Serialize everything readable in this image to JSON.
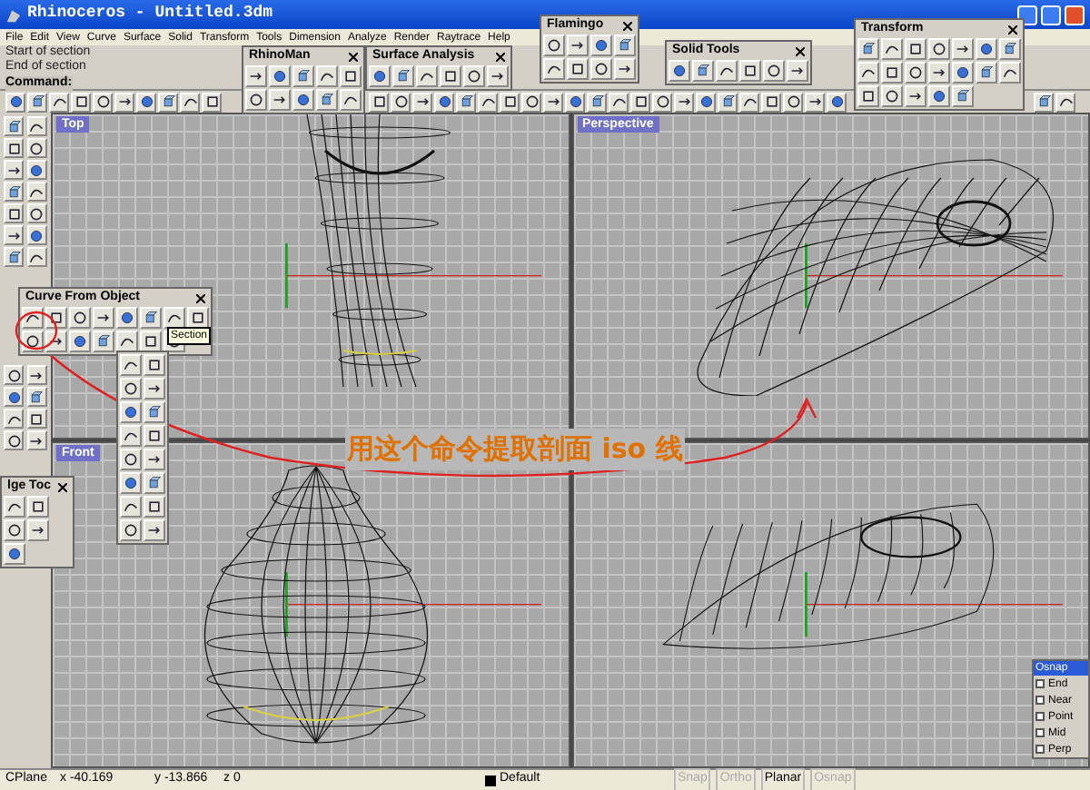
{
  "window": {
    "title": "Rhinoceros - Untitled.3dm"
  },
  "menu": [
    "File",
    "Edit",
    "View",
    "Curve",
    "Surface",
    "Solid",
    "Transform",
    "Tools",
    "Dimension",
    "Analyze",
    "Render",
    "Raytrace",
    "Help"
  ],
  "command_history": [
    "Start of section",
    "End of section"
  ],
  "command_prompt": "Command:",
  "viewports": [
    {
      "label": "Top",
      "kind": "vase"
    },
    {
      "label": "Perspective",
      "kind": "perspective"
    },
    {
      "label": "Front",
      "kind": "bulb"
    },
    {
      "kind": "side"
    }
  ],
  "annotation": "用这个命令提取剖面 iso 线",
  "floating_toolbars": [
    {
      "title": "RhinoMan",
      "kind": "rhinoman"
    },
    {
      "title": "Surface Analysis",
      "kind": "surface"
    },
    {
      "title": "Flamingo",
      "kind": "flamingo"
    },
    {
      "title": "Solid Tools",
      "kind": "solid"
    },
    {
      "title": "Transform",
      "kind": "transform"
    },
    {
      "title": "Curve From Object",
      "kind": "curve"
    },
    {
      "title": "lge Toc",
      "kind": "edge"
    }
  ],
  "tooltip": "Section",
  "osnap": {
    "title": "Osnap",
    "options": [
      {
        "label": "End",
        "checked": false
      },
      {
        "label": "Near",
        "checked": false
      },
      {
        "label": "Point",
        "checked": false
      },
      {
        "label": "Mid",
        "checked": false
      },
      {
        "label": "Perp",
        "checked": false
      }
    ]
  },
  "status_bar": {
    "cplane": "CPlane",
    "x": "x -40.169",
    "y": "y -13.866",
    "z": "z 0",
    "layer": "Default",
    "toggles": [
      {
        "label": "Snap",
        "on": false
      },
      {
        "label": "Ortho",
        "on": false
      },
      {
        "label": "Planar",
        "on": true
      },
      {
        "label": "Osnap",
        "on": false
      }
    ]
  }
}
